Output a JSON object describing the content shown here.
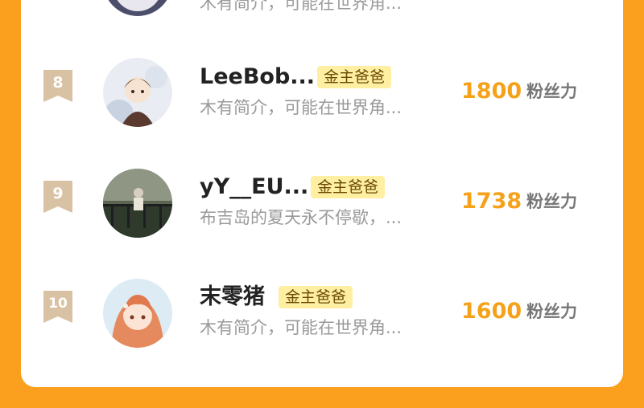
{
  "list": {
    "partial_top_bio": "木有简介，可能在世界角...",
    "entries": [
      {
        "rank": "8",
        "name": "LeeBob...",
        "badge": "金主爸爸",
        "bio": "木有简介，可能在世界角...",
        "score": "1800",
        "score_unit": "粉丝力",
        "avatar": "anime-character-avatar"
      },
      {
        "rank": "9",
        "name": "yY__EU...",
        "badge": "金主爸爸",
        "bio": "布吉岛的夏天永不停歇，...",
        "score": "1738",
        "score_unit": "粉丝力",
        "avatar": "outdoor-photo-avatar"
      },
      {
        "rank": "10",
        "name": "末零猪",
        "badge": "金主爸爸",
        "bio": "木有简介，可能在世界角...",
        "score": "1600",
        "score_unit": "粉丝力",
        "avatar": "orange-hair-anime-avatar"
      }
    ]
  },
  "colors": {
    "background": "#FBA01E",
    "card": "#FFFFFF",
    "score": "#F5A21A",
    "badge_bg": "#FFEFA3",
    "rank_ribbon": "#D9C2A3"
  }
}
